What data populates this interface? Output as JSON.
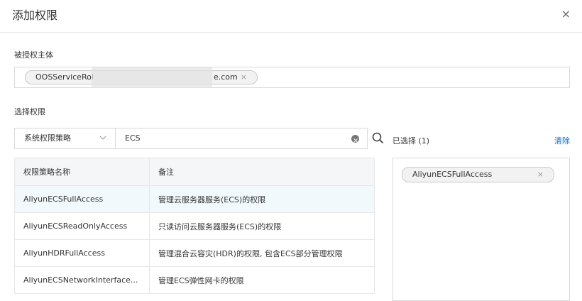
{
  "dialog": {
    "title": "添加权限",
    "close_glyph": "×"
  },
  "principal": {
    "label": "被授权主体",
    "tag_prefix": "OOSServiceRol",
    "tag_suffix": "e.com",
    "remove_glyph": "×"
  },
  "permissions": {
    "label": "选择权限",
    "policy_type": "系统权限策略",
    "search_value": "ECS"
  },
  "table": {
    "headers": [
      "权限策略名称",
      "备注"
    ],
    "rows": [
      {
        "name": "AliyunECSFullAccess",
        "note": "管理云服务器服务(ECS)的权限"
      },
      {
        "name": "AliyunECSReadOnlyAccess",
        "note": "只读访问云服务器服务(ECS)的权限"
      },
      {
        "name": "AliyunHDRFullAccess",
        "note": "管理混合云容灾(HDR)的权限, 包含ECS部分管理权限"
      },
      {
        "name": "AliyunECSNetworkInterface...",
        "note": "管理ECS弹性网卡的权限"
      }
    ]
  },
  "selected": {
    "title": "已选择 (1)",
    "clear_label": "清除",
    "items": [
      "AliyunECSFullAccess"
    ],
    "remove_glyph": "×"
  }
}
